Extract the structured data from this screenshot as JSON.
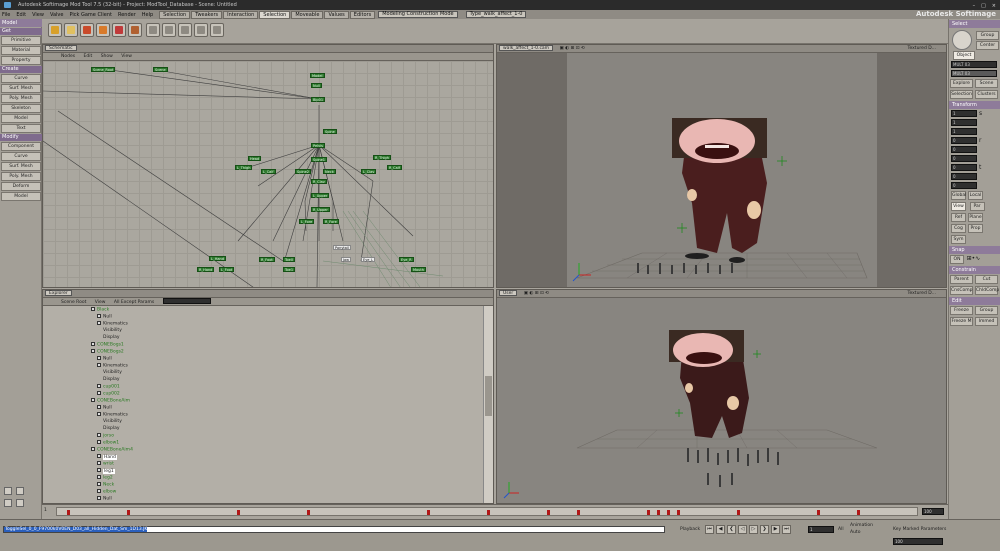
{
  "app": {
    "title": "Autodesk Softimage Mod Tool 7.5 (32-bit) - Project: ModTool_Database - Scene: Untitled",
    "brand": "Autodesk Softimage"
  },
  "menubar": {
    "items": [
      "File",
      "Edit",
      "View",
      "Valve",
      "Pick Game Client",
      "Render",
      "Help",
      "Model",
      "Animate",
      "Render",
      "Simulate",
      "Hair"
    ],
    "tabs": [
      "Selection",
      "Tweakers",
      "Interaction",
      "Selection",
      "Moveable",
      "Values",
      "Editors"
    ],
    "combos": [
      "Modeling Construction Mode",
      "Type_walk_affect_1-0"
    ]
  },
  "left_panel": {
    "mode": "Model",
    "sections": [
      {
        "title": "Get",
        "items": [
          "Primitive",
          "Material",
          "Property"
        ]
      },
      {
        "title": "Create",
        "items": [
          "Curve",
          "Surf. Mesh",
          "Poly. Mesh",
          "Skeleton",
          "Model",
          "Text"
        ]
      },
      {
        "title": "Modify",
        "items": [
          "Component",
          "Curve",
          "Surf. Mesh",
          "Poly. Mesh",
          "Deform",
          "Model"
        ]
      }
    ]
  },
  "right_panel": {
    "header": "Select",
    "buttons_top": [
      "Group",
      "Center",
      "Object"
    ],
    "fields_top": [
      "MULT 03",
      "MULT 03"
    ],
    "buttons_mid": [
      "Explore",
      "Scene",
      "Selection",
      "Clusters"
    ],
    "transform_title": "Transform",
    "transform_values": [
      "1",
      "1",
      "1",
      "0",
      "0",
      "0",
      "0",
      "0",
      "0"
    ],
    "axis_buttons": [
      "Global",
      "Local",
      "View",
      "Par",
      "Ref",
      "Plane",
      "Cog",
      "Prop",
      "Sym"
    ],
    "snap_title": "Snap",
    "snap_values": [
      "ON"
    ],
    "constrain_title": "Constrain",
    "constrain_buttons": [
      "Parent",
      "Cut",
      "CnsComp",
      "ChldComp"
    ],
    "edit_title": "Edit",
    "edit_buttons": [
      "Freeze",
      "Group",
      "Freeze M",
      "Immed"
    ]
  },
  "schematic": {
    "title": "Schematic",
    "menus": [
      "Nodes",
      "Edit",
      "Show",
      "View"
    ],
    "nodes": [
      {
        "label": "Scene_Root"
      },
      {
        "label": "Scene"
      },
      {
        "label": "Model"
      },
      {
        "label": "Null"
      },
      {
        "label": "Bip01"
      },
      {
        "label": "Pelvis"
      },
      {
        "label": "Spine"
      },
      {
        "label": "Spine1"
      },
      {
        "label": "Spine2"
      },
      {
        "label": "Neck"
      },
      {
        "label": "Head"
      },
      {
        "label": "L_Thigh"
      },
      {
        "label": "L_Calf"
      },
      {
        "label": "R_Thigh"
      },
      {
        "label": "R_Calf"
      },
      {
        "label": "L_Clav"
      },
      {
        "label": "R_Clav"
      },
      {
        "label": "L_Upper"
      },
      {
        "label": "R_Upper"
      },
      {
        "label": "L_Fore"
      },
      {
        "label": "R_Fore"
      },
      {
        "label": "L_Hand"
      },
      {
        "label": "R_Hand"
      },
      {
        "label": "L_Foot"
      },
      {
        "label": "R_Foot"
      },
      {
        "label": "Toe0"
      },
      {
        "label": "Toe1"
      },
      {
        "label": "Ponytail"
      },
      {
        "label": "Jaw"
      },
      {
        "label": "Eye_L"
      },
      {
        "label": "Eye_R"
      },
      {
        "label": "Mouth"
      }
    ]
  },
  "viewport_top_right": {
    "camera": "walk_affect_1-0.cam",
    "shading": "Textured D..."
  },
  "explorer": {
    "title": "Explorer",
    "menus": [
      "Scene Root",
      "View",
      "All Except Params"
    ],
    "rows": [
      {
        "label": "Black",
        "green": true
      },
      {
        "label": "Null",
        "green": false
      },
      {
        "label": "Kinematics",
        "green": false
      },
      {
        "label": "Visibility",
        "green": false
      },
      {
        "label": "Display",
        "green": false
      },
      {
        "label": "CONEBogs1",
        "green": true
      },
      {
        "label": "CONEBogs2",
        "green": true
      },
      {
        "label": "Null",
        "green": false
      },
      {
        "label": "Kinematics",
        "green": false
      },
      {
        "label": "Visibility",
        "green": false
      },
      {
        "label": "Display",
        "green": false
      },
      {
        "label": "cup001",
        "green": true
      },
      {
        "label": "cup002",
        "green": true
      },
      {
        "label": "CONEBoneAim",
        "green": true
      },
      {
        "label": "Null",
        "green": false
      },
      {
        "label": "Kinematics",
        "green": false
      },
      {
        "label": "Visibility",
        "green": false
      },
      {
        "label": "Display",
        "green": false
      },
      {
        "label": "jorso",
        "green": true
      },
      {
        "label": "elbow1",
        "green": true
      },
      {
        "label": "CONEBoneAim4",
        "green": true
      },
      {
        "label": "Hand",
        "green": false
      },
      {
        "label": "wrist",
        "green": true
      },
      {
        "label": "leg1",
        "green": false
      },
      {
        "label": "leg2",
        "green": true
      },
      {
        "label": "Neck",
        "green": true
      },
      {
        "label": "elbow",
        "green": true
      },
      {
        "label": "Null",
        "green": false
      }
    ]
  },
  "viewport_bottom_right": {
    "camera": "User",
    "shading": "Textured D..."
  },
  "timeline": {
    "start": "1",
    "end": "100"
  },
  "statusbar": {
    "command": "ToggleSel_0_0_F9700k0V0EN_D03_all_Hidden_Dat_Sm_1D13.JK",
    "playback_label": "Playback",
    "frame": "1",
    "frame_end": "100",
    "key_label": "Key Marked Parameters",
    "all_label": "All",
    "animation_label": "Animation",
    "auto_label": "Auto"
  },
  "colors": {
    "accent": "#8e7b9a",
    "node": "#2f7a2f",
    "key": "#b01818"
  }
}
